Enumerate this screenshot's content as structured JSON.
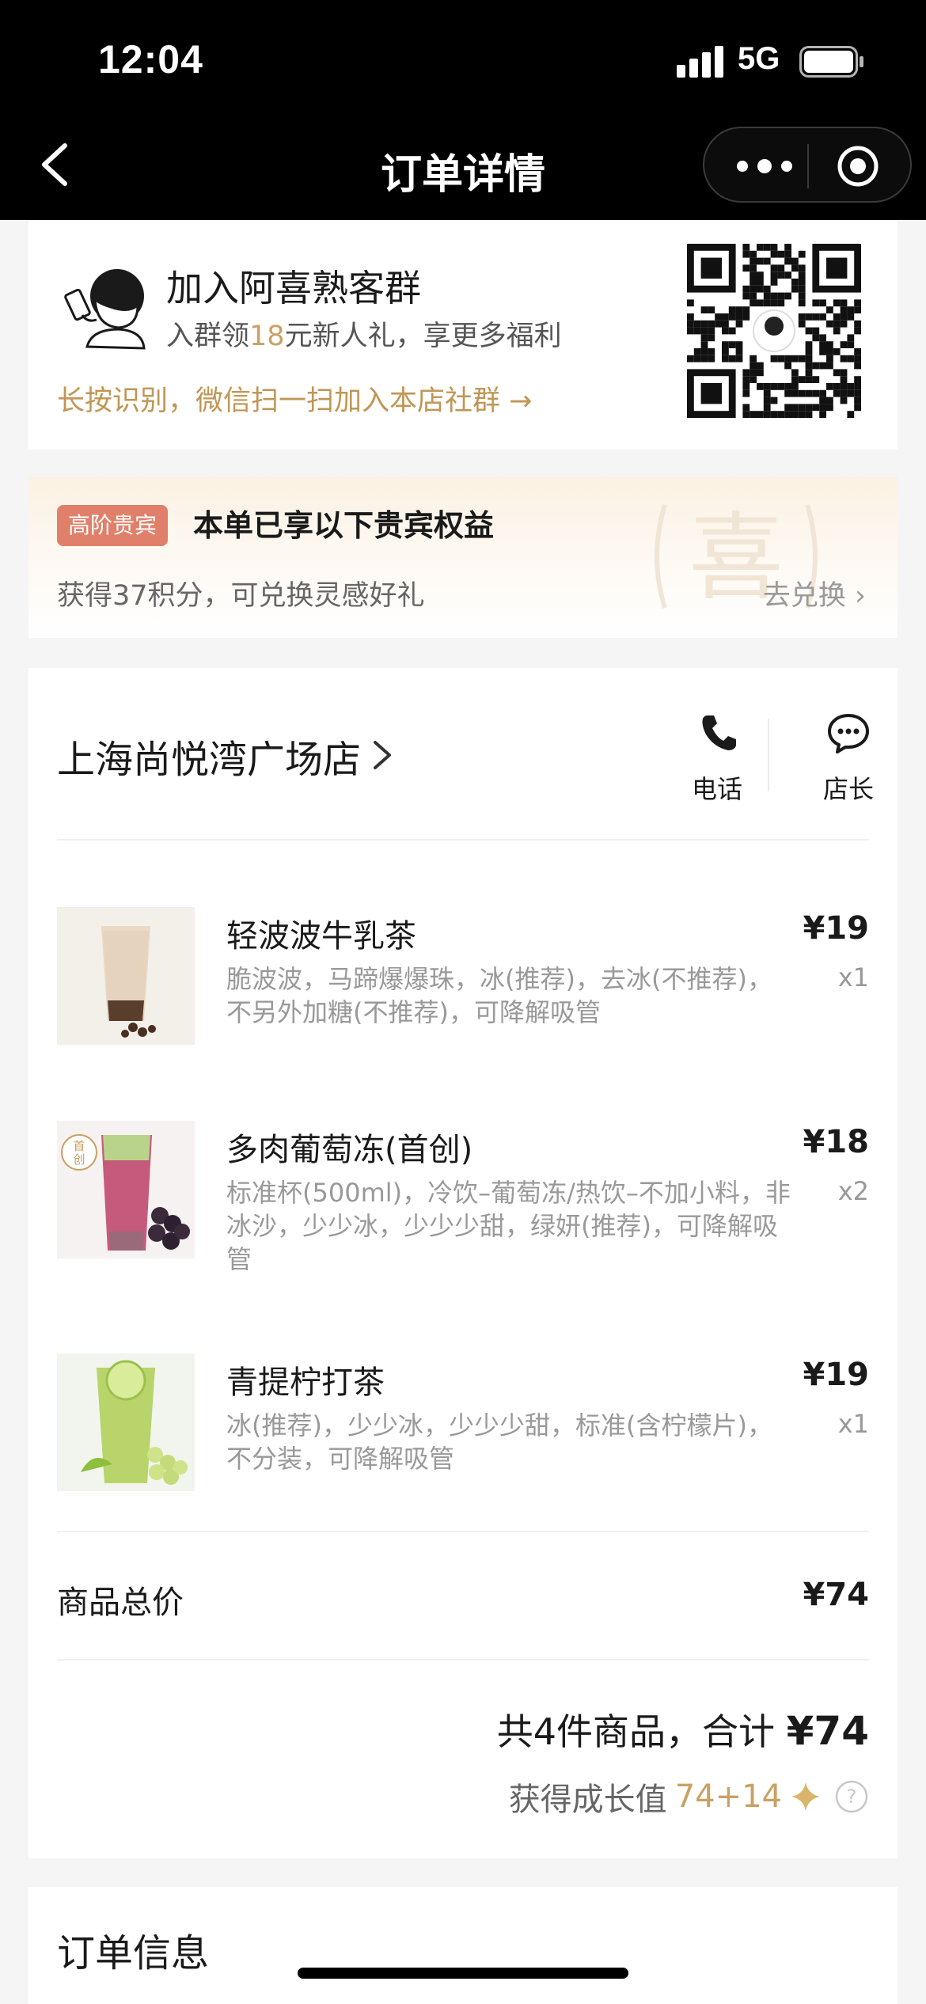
{
  "status_bar": {
    "time": "12:04",
    "network": "5G"
  },
  "nav": {
    "title": "订单详情",
    "back_icon": "chevron-left-icon",
    "more_icon": "more-dots-icon",
    "close_icon": "target-icon"
  },
  "group": {
    "title": "加入阿喜熟客群",
    "subtitle_pre": "入群领",
    "subtitle_amount": "18",
    "subtitle_post": "元新人礼，享更多福利",
    "link": "长按识别，微信扫一扫加入本店社群 →"
  },
  "vip": {
    "badge": "高阶贵宾",
    "title": "本单已享以下贵宾权益",
    "desc": "获得37积分，可兑换灵感好礼",
    "action": "去兑换 ›"
  },
  "store": {
    "name": "上海尚悦湾广场店",
    "call_label": "电话",
    "manager_label": "店长"
  },
  "items": [
    {
      "name": "轻波波牛乳茶",
      "spec": "脆波波，马蹄爆爆珠，冰(推荐)，去冰(不推荐)，不另外加糖(不推荐)，可降解吸管",
      "price": "¥19",
      "qty": "x1"
    },
    {
      "name": "多肉葡萄冻(首创)",
      "spec": "标准杯(500ml)，冷饮–葡萄冻/热饮–不加小料，非冰沙，少少冰，少少少甜，绿妍(推荐)，可降解吸管",
      "price": "¥18",
      "qty": "x2",
      "badge": "首创"
    },
    {
      "name": "青提柠打茶",
      "spec": "冰(推荐)，少少冰，少少少甜，标准(含柠檬片)，不分装，可降解吸管",
      "price": "¥19",
      "qty": "x1"
    }
  ],
  "totals": {
    "goods_label": "商品总价",
    "goods_value": "¥74",
    "summary_pre": "共4件商品，合计 ",
    "summary_amount": "¥74",
    "growth_label": "获得成长值",
    "growth_value": "74+14"
  },
  "order_info": {
    "title": "订单信息"
  },
  "colors": {
    "accent_gold": "#c9a163",
    "vip_badge": "#e0806a",
    "top_bar": "#000000"
  }
}
